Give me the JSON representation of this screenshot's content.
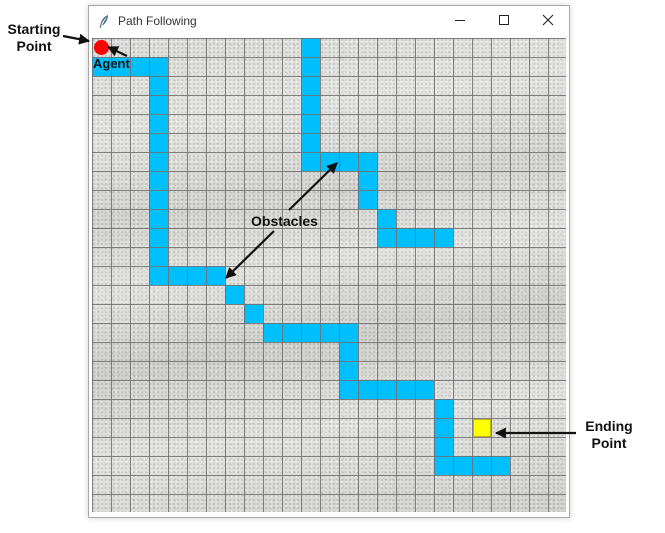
{
  "window": {
    "title": "Path Following",
    "icon": "feather-icon",
    "controls": [
      "minimize-icon",
      "maximize-icon",
      "close-icon"
    ]
  },
  "grid": {
    "rows": 25,
    "cols": 25,
    "line_color": "#6e6e6e",
    "obstacle_color": "#00bfff",
    "agent_color": "#ff0000",
    "goal_color": "#ffff00",
    "agent_cell": [
      0,
      0
    ],
    "goal_cell": [
      20,
      20
    ],
    "obstacle_cells": [
      [
        1,
        0
      ],
      [
        1,
        1
      ],
      [
        1,
        2
      ],
      [
        1,
        3
      ],
      [
        2,
        3
      ],
      [
        3,
        3
      ],
      [
        4,
        3
      ],
      [
        5,
        3
      ],
      [
        6,
        3
      ],
      [
        7,
        3
      ],
      [
        8,
        3
      ],
      [
        9,
        3
      ],
      [
        10,
        3
      ],
      [
        11,
        3
      ],
      [
        12,
        3
      ],
      [
        12,
        4
      ],
      [
        12,
        5
      ],
      [
        12,
        6
      ],
      [
        13,
        7
      ],
      [
        14,
        8
      ],
      [
        15,
        9
      ],
      [
        15,
        10
      ],
      [
        15,
        11
      ],
      [
        15,
        12
      ],
      [
        15,
        13
      ],
      [
        16,
        13
      ],
      [
        17,
        13
      ],
      [
        18,
        13
      ],
      [
        18,
        14
      ],
      [
        18,
        15
      ],
      [
        18,
        16
      ],
      [
        18,
        17
      ],
      [
        19,
        18
      ],
      [
        20,
        18
      ],
      [
        21,
        18
      ],
      [
        22,
        18
      ],
      [
        22,
        19
      ],
      [
        22,
        20
      ],
      [
        22,
        21
      ],
      [
        0,
        11
      ],
      [
        1,
        11
      ],
      [
        2,
        11
      ],
      [
        3,
        11
      ],
      [
        4,
        11
      ],
      [
        5,
        11
      ],
      [
        6,
        11
      ],
      [
        6,
        12
      ],
      [
        6,
        13
      ],
      [
        6,
        14
      ],
      [
        7,
        14
      ],
      [
        8,
        14
      ],
      [
        9,
        15
      ],
      [
        10,
        15
      ],
      [
        10,
        16
      ],
      [
        10,
        17
      ],
      [
        10,
        18
      ]
    ]
  },
  "annotations": {
    "starting_point": "Starting\nPoint",
    "agent": "Agent",
    "obstacles": "Obstacles",
    "ending_point": "Ending\nPoint"
  }
}
